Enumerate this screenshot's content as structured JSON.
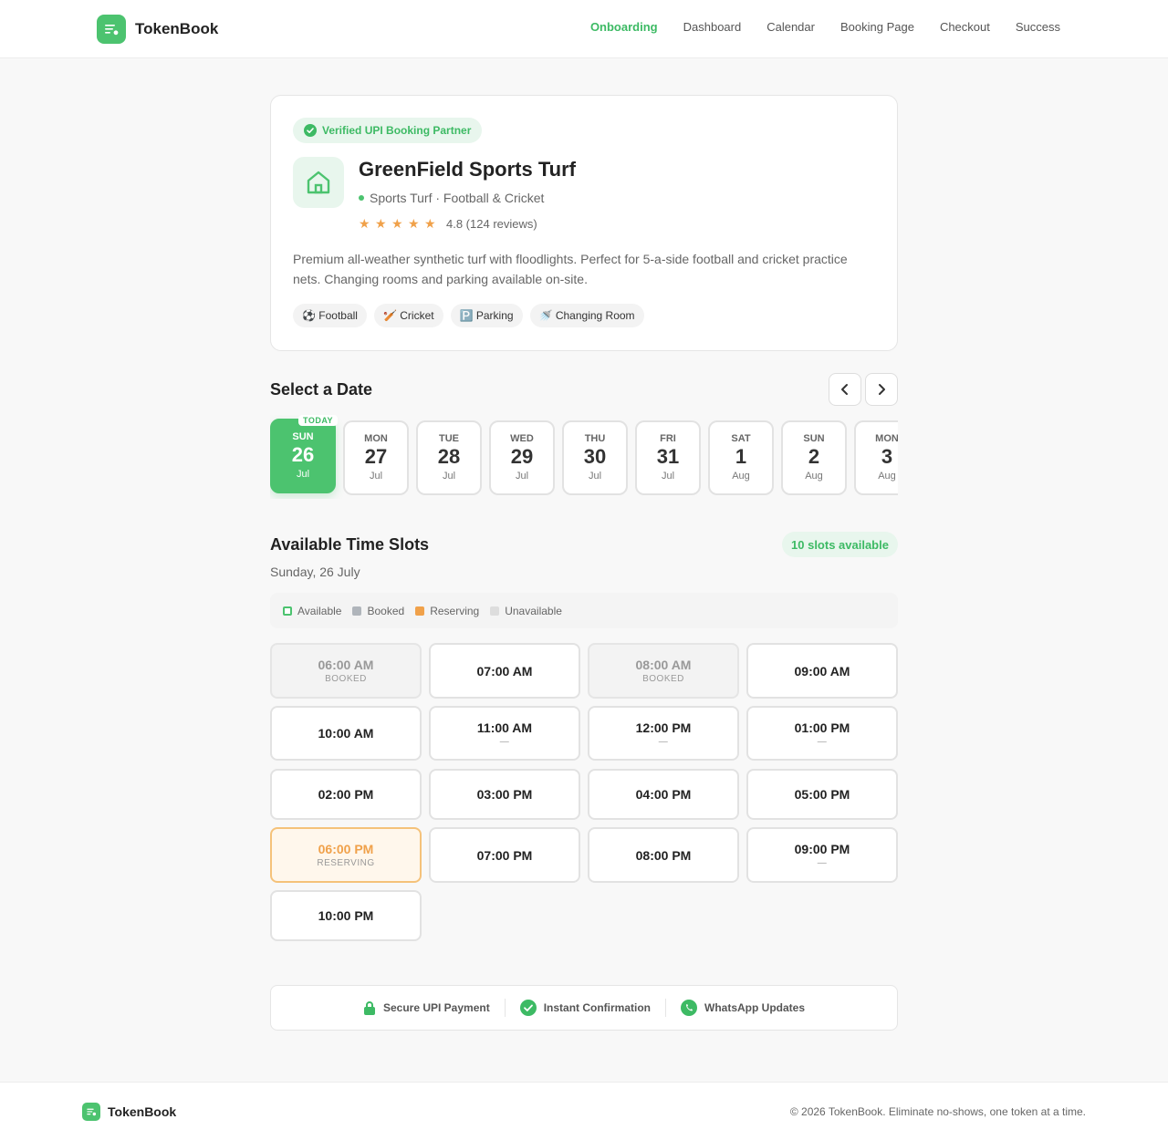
{
  "app": {
    "name": "TokenBook"
  },
  "nav": [
    "Onboarding",
    "Dashboard",
    "Calendar",
    "Booking Page",
    "Checkout",
    "Success"
  ],
  "venue": {
    "badge": "Verified UPI Booking Partner",
    "name": "GreenField Sports Turf",
    "category": "Sports Turf · Football & Cricket",
    "rating_stars": 5,
    "rating_text": "4.8 (124 reviews)",
    "description": "Premium all-weather synthetic turf with floodlights. Perfect for 5-a-side football and cricket practice nets. Changing rooms and parking available on-site.",
    "tags": [
      "⚽ Football",
      "🏏 Cricket",
      "🅿️ Parking",
      "🚿 Changing Room"
    ]
  },
  "date_section": {
    "title": "Select a Date",
    "today_label": "TODAY",
    "dates": [
      {
        "dow": "SUN",
        "day": "26",
        "month": "Jul",
        "selected": true,
        "today": true
      },
      {
        "dow": "MON",
        "day": "27",
        "month": "Jul"
      },
      {
        "dow": "TUE",
        "day": "28",
        "month": "Jul"
      },
      {
        "dow": "WED",
        "day": "29",
        "month": "Jul"
      },
      {
        "dow": "THU",
        "day": "30",
        "month": "Jul"
      },
      {
        "dow": "FRI",
        "day": "31",
        "month": "Jul"
      },
      {
        "dow": "SAT",
        "day": "1",
        "month": "Aug"
      },
      {
        "dow": "SUN",
        "day": "2",
        "month": "Aug"
      },
      {
        "dow": "MON",
        "day": "3",
        "month": "Aug"
      }
    ]
  },
  "slots_section": {
    "title": "Available Time Slots",
    "badge": "10 slots available",
    "date_label": "Sunday, 26 July",
    "legend": [
      {
        "label": "Available",
        "color": "#ffffff",
        "border": "#4cc36f"
      },
      {
        "label": "Booked",
        "color": "#b0b5bb"
      },
      {
        "label": "Reserving",
        "color": "#f0a14a"
      },
      {
        "label": "Unavailable",
        "color": "#dddddd"
      }
    ],
    "slots": [
      {
        "time": "06:00 AM",
        "status": "booked",
        "sub": "BOOKED"
      },
      {
        "time": "07:00 AM",
        "status": "available"
      },
      {
        "time": "08:00 AM",
        "status": "booked",
        "sub": "BOOKED"
      },
      {
        "time": "09:00 AM",
        "status": "available"
      },
      {
        "time": "10:00 AM",
        "status": "available"
      },
      {
        "time": "11:00 AM",
        "status": "unavailable",
        "sub": "—"
      },
      {
        "time": "12:00 PM",
        "status": "unavailable",
        "sub": "—"
      },
      {
        "time": "01:00 PM",
        "status": "unavailable",
        "sub": "—"
      },
      {
        "time": "02:00 PM",
        "status": "available"
      },
      {
        "time": "03:00 PM",
        "status": "available"
      },
      {
        "time": "04:00 PM",
        "status": "available"
      },
      {
        "time": "05:00 PM",
        "status": "available"
      },
      {
        "time": "06:00 PM",
        "status": "reserving",
        "sub": "RESERVING"
      },
      {
        "time": "07:00 PM",
        "status": "available"
      },
      {
        "time": "08:00 PM",
        "status": "available"
      },
      {
        "time": "09:00 PM",
        "status": "unavailable",
        "sub": "—"
      },
      {
        "time": "10:00 PM",
        "status": "available"
      }
    ]
  },
  "trust": [
    "Secure UPI Payment",
    "Instant Confirmation",
    "WhatsApp Updates"
  ],
  "footer": {
    "brand": "TokenBook",
    "copyright": "© 2026 TokenBook. Eliminate no-shows, one token at a time."
  },
  "colors": {
    "accent": "#4cc36f",
    "reserving": "#f0a14a"
  }
}
